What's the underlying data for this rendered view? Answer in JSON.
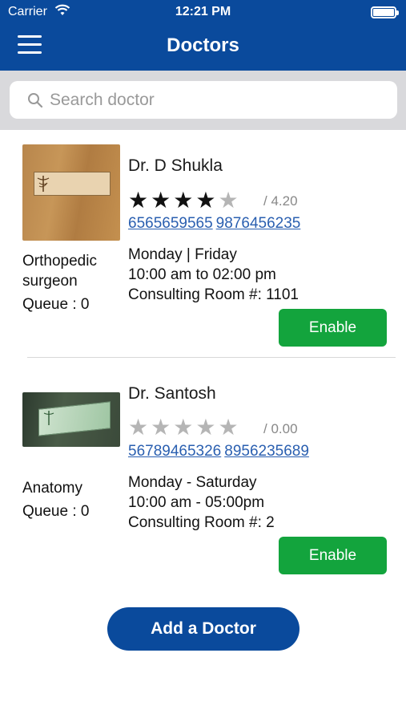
{
  "status_bar": {
    "carrier": "Carrier",
    "time": "12:21 PM"
  },
  "header": {
    "title": "Doctors"
  },
  "search": {
    "placeholder": "Search doctor"
  },
  "doctors": [
    {
      "name": "Dr. D Shukla",
      "rating_value": "/ 4.20",
      "stars_filled": 4,
      "stars_total": 5,
      "phones": [
        "6565659565",
        "9876456235"
      ],
      "specialty": [
        "Orthopedic",
        "surgeon"
      ],
      "queue": "Queue : 0",
      "schedule": [
        "Monday | Friday",
        "10:00 am to 02:00 pm",
        "Consulting Room #: 1101"
      ],
      "button": "Enable"
    },
    {
      "name": "Dr. Santosh",
      "rating_value": "/ 0.00",
      "stars_filled": 0,
      "stars_total": 5,
      "phones": [
        "56789465326",
        "8956235689"
      ],
      "specialty": [
        "Anatomy"
      ],
      "queue": "Queue : 0",
      "schedule": [
        "Monday - Saturday",
        "10:00 am - 05:00pm",
        "Consulting Room #: 2"
      ],
      "button": "Enable"
    }
  ],
  "add_button": "Add a Doctor",
  "colors": {
    "header": "#0a4a9c",
    "enable": "#13a43d",
    "link": "#2a5fb0"
  },
  "icons": {
    "menu": "hamburger-icon",
    "search": "magnifier-icon",
    "wifi": "wifi-icon",
    "battery": "battery-icon"
  }
}
